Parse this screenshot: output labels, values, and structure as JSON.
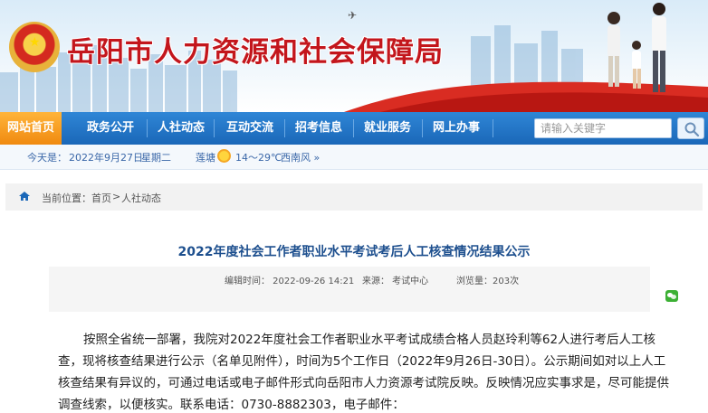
{
  "header": {
    "site_title": "岳阳市人力资源和社会保障局",
    "emblem": "national-emblem"
  },
  "nav": {
    "items": [
      {
        "label": "网站首页",
        "active": true
      },
      {
        "label": "政务公开",
        "active": false
      },
      {
        "label": "人社动态",
        "active": false
      },
      {
        "label": "互动交流",
        "active": false
      },
      {
        "label": "招考信息",
        "active": false
      },
      {
        "label": "就业服务",
        "active": false
      },
      {
        "label": "网上办事",
        "active": false
      }
    ],
    "search": {
      "placeholder": "请输入关键字",
      "icon": "search-icon"
    }
  },
  "info_bar": {
    "today_label": "今天是：",
    "date": "2022年9月27日",
    "weekday": "星期二",
    "weather_city": "莲塘",
    "weather_icon": "sun-icon",
    "temperature": "14～29℃",
    "wind": "西南风 »"
  },
  "breadcrumb": {
    "label": "当前位置：",
    "home": "首页",
    "sep": ">",
    "current": "人社动态"
  },
  "article": {
    "title": "2022年度社会工作者职业水平考试考后人工核查情况结果公示",
    "meta": {
      "time": "编辑时间： 2022-09-26 14:21",
      "source": "来源： 考试中心",
      "views": "浏览量：203次"
    },
    "paragraph": "按照全省统一部署，我院对2022年度社会工作者职业水平考试成绩合格人员赵玲利等62人进行考后人工核查，现将核查结果进行公示（名单见附件），时间为5个工作日（2022年9月26日-30日）。公示期间如对以上人工核查结果有异议的，可通过电话或电子邮件形式向岳阳市人力资源考试院反映。反映情况应实事求是，尽可能提供调查线索，以便核实。联系电话：0730-8882303，电子邮件："
  },
  "colors": {
    "brand_red": "#c3161c",
    "nav_blue": "#1a67b8",
    "nav_active": "#f08a10",
    "title_blue": "#1d4f8e"
  }
}
